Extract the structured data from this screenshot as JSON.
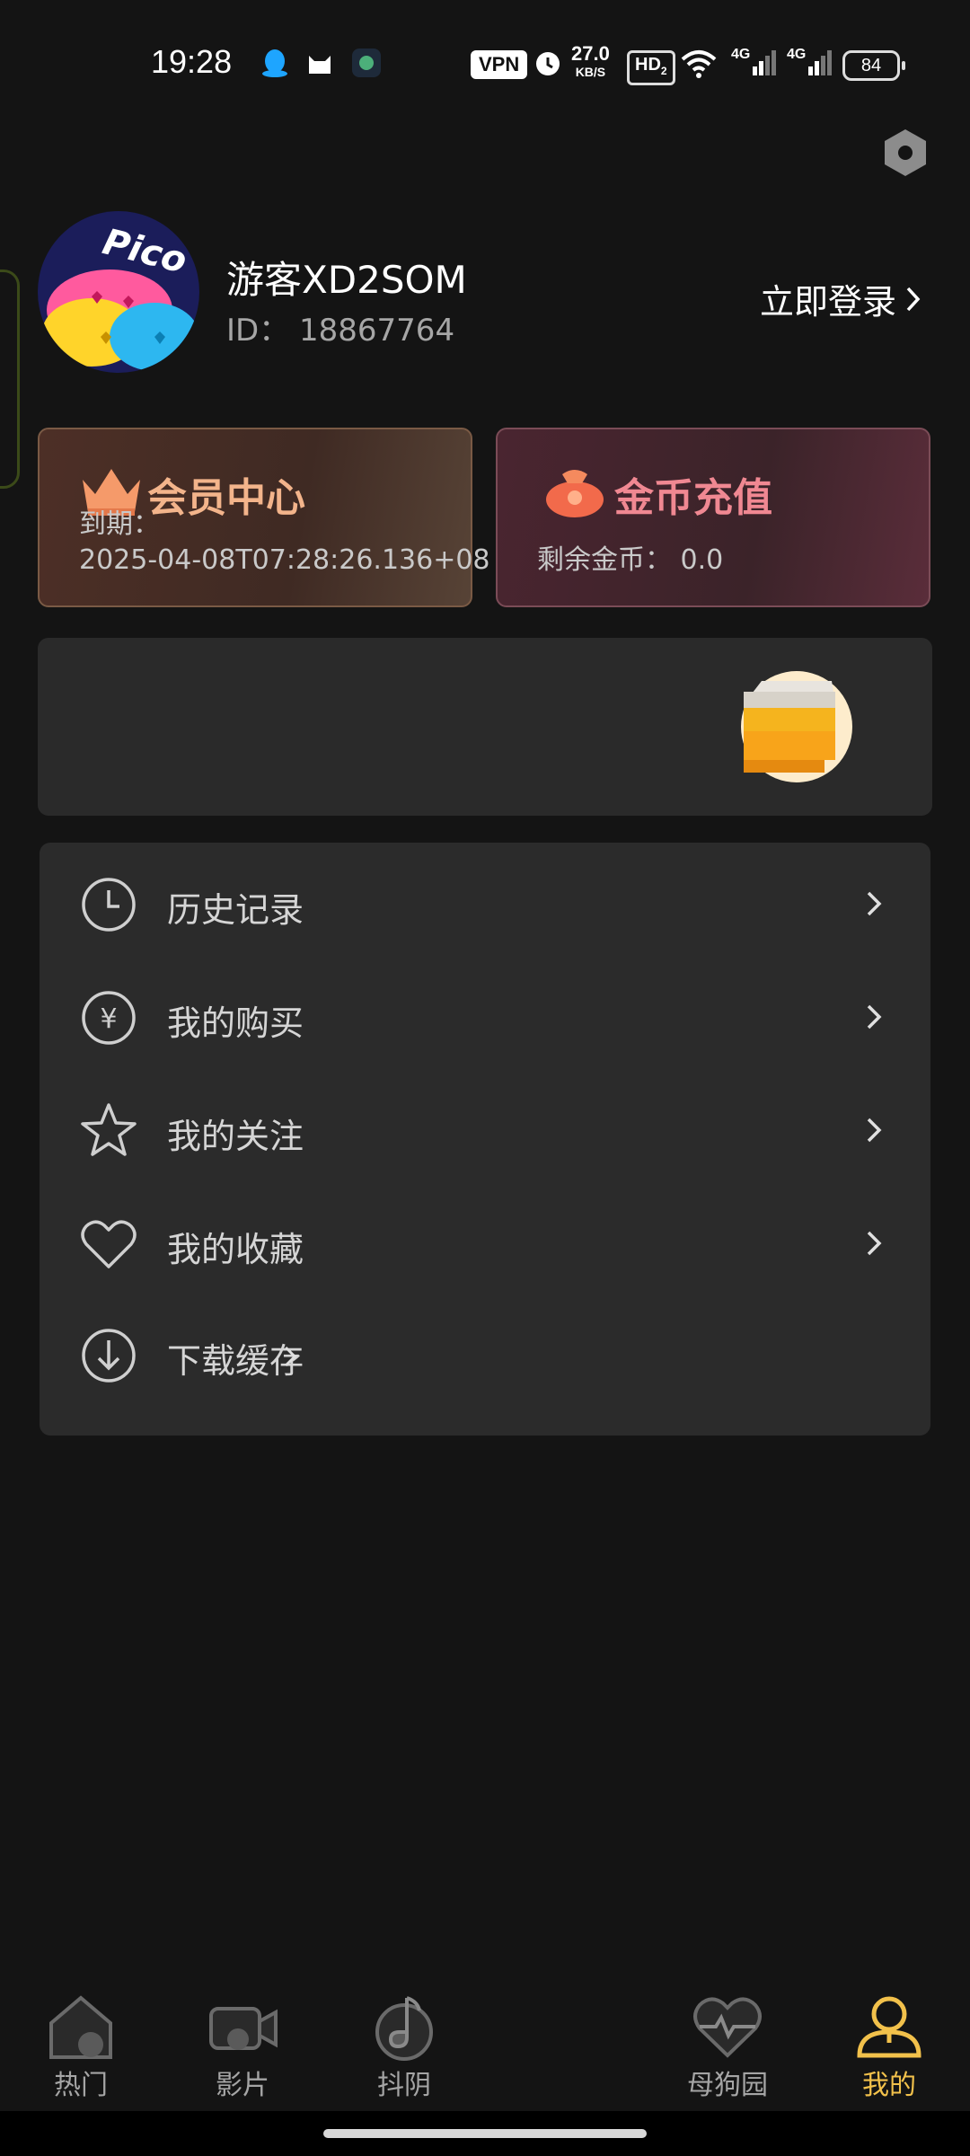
{
  "status_bar": {
    "time": "19:28",
    "vpn": "VPN",
    "speed_value": "27.0",
    "speed_unit": "KB/S",
    "hd": "HD",
    "hd_sub": "2",
    "signal1": "4G",
    "signal2": "4G",
    "battery": "84"
  },
  "profile": {
    "avatar_text": "Pico",
    "username": "游客XD2SOM",
    "id_text": "ID：  18867764",
    "login_label": "立即登录"
  },
  "vip_card": {
    "title": "会员中心",
    "expire_label": "到期：",
    "expire_value": "2025-04-08T07:28:26.136+08"
  },
  "coin_card": {
    "title": "金币充值",
    "balance": "剩余金币：  0.0"
  },
  "menu": {
    "items": [
      {
        "label": "历史记录",
        "icon": "clock-icon"
      },
      {
        "label": "我的购买",
        "icon": "yen-icon"
      },
      {
        "label": "我的关注",
        "icon": "star-icon"
      },
      {
        "label": "我的收藏",
        "icon": "heart-icon"
      },
      {
        "label": "下载缓存",
        "icon": "download-icon"
      }
    ]
  },
  "tabs": [
    {
      "label": "热门",
      "icon": "home-icon"
    },
    {
      "label": "影片",
      "icon": "video-icon"
    },
    {
      "label": "抖阴",
      "icon": "music-icon"
    },
    {
      "label": "母狗园",
      "icon": "heart-pulse-icon"
    },
    {
      "label": "我的",
      "icon": "user-icon"
    }
  ],
  "colors": {
    "background": "#141414",
    "card": "#2b2b2b",
    "vip_accent": "#f3b48b",
    "coin_accent": "#f08892",
    "active_tab": "#f2c14b"
  }
}
